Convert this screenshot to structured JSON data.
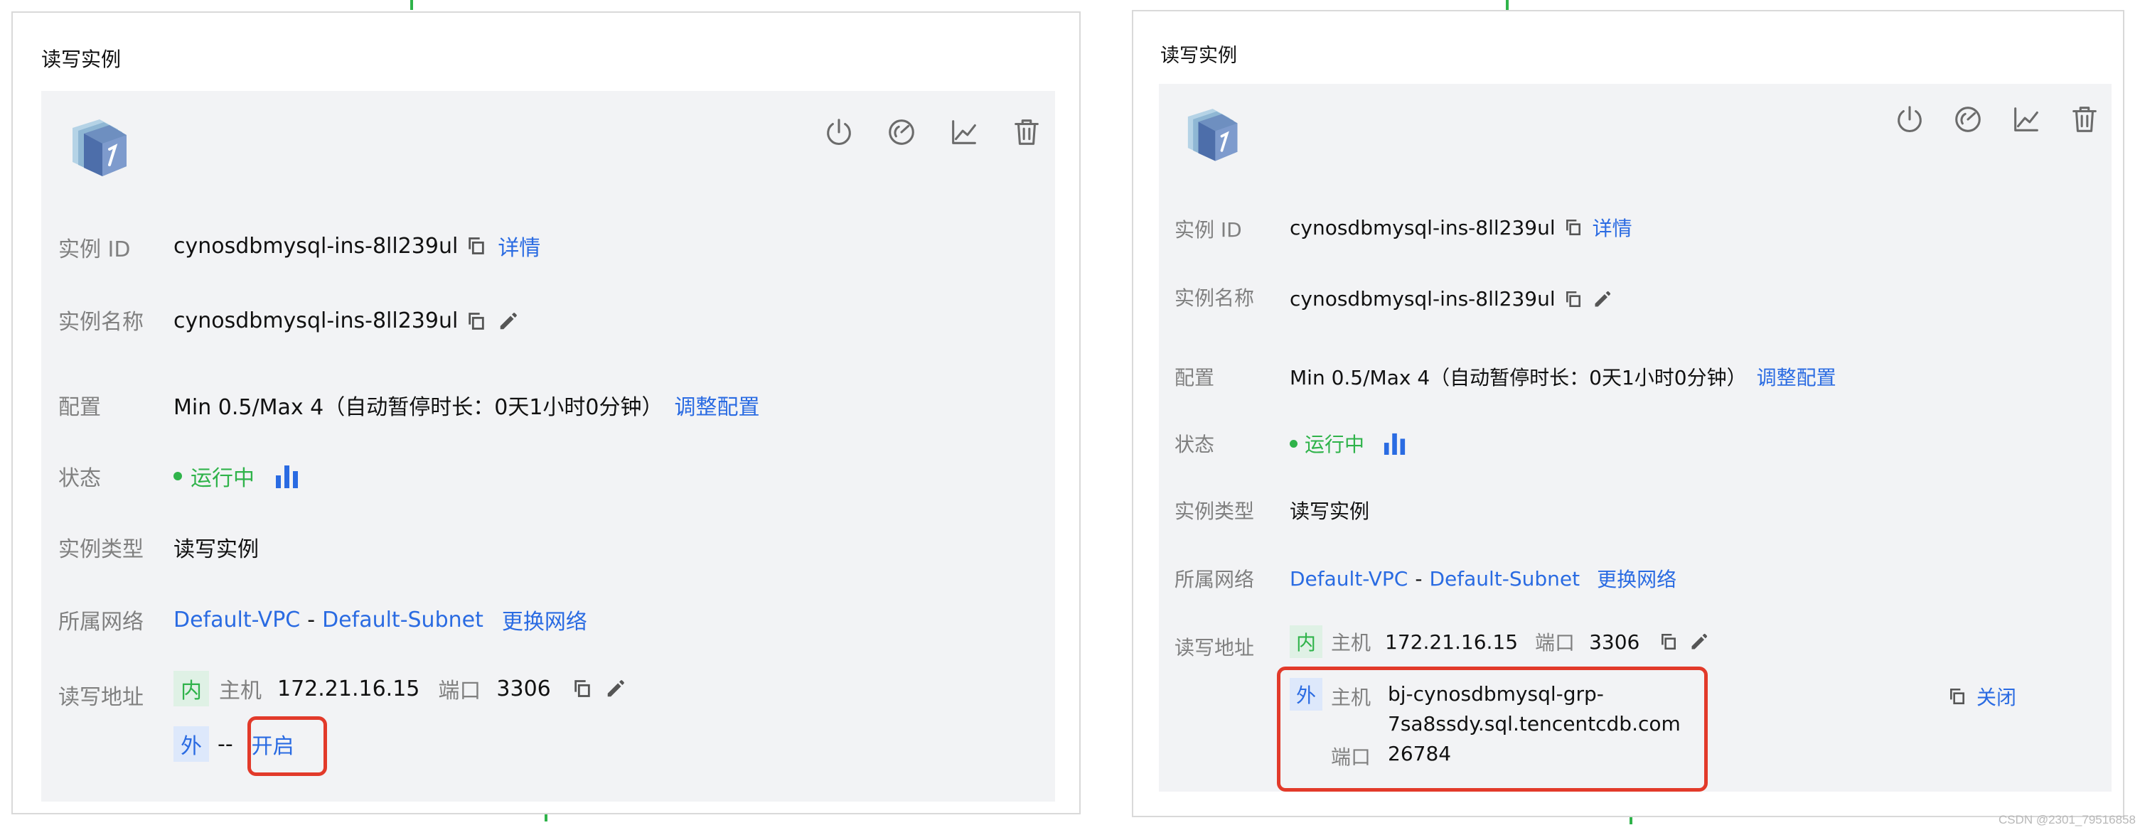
{
  "left": {
    "section_title": "读写实例",
    "toolbar_icons": [
      "power-icon",
      "gauge-icon",
      "line-chart-icon",
      "trash-icon"
    ],
    "instance_id_label": "实例 ID",
    "instance_id_value": "cynosdbmysql-ins-8ll239ul",
    "detail_link": "详情",
    "instance_name_label": "实例名称",
    "instance_name_value": "cynosdbmysql-ins-8ll239ul",
    "config_label": "配置",
    "config_value": "Min 0.5/Max 4（自动暂停时长：0天1小时0分钟）",
    "adjust_config_link": "调整配置",
    "status_label": "状态",
    "status_value": "运行中",
    "type_label": "实例类型",
    "type_value": "读写实例",
    "network_label": "所属网络",
    "vpc_link": "Default-VPC",
    "network_separator": "-",
    "subnet_link": "Default-Subnet",
    "change_network_link": "更换网络",
    "address_label": "读写地址",
    "internal_badge": "内",
    "host_label": "主机",
    "host_value": "172.21.16.15",
    "port_label": "端口",
    "port_value": "3306",
    "external_badge": "外",
    "external_placeholder": "--",
    "enable_link": "开启"
  },
  "right": {
    "section_title": "读写实例",
    "toolbar_icons": [
      "power-icon",
      "gauge-icon",
      "line-chart-icon",
      "trash-icon"
    ],
    "instance_id_label": "实例 ID",
    "instance_id_value": "cynosdbmysql-ins-8ll239ul",
    "detail_link": "详情",
    "instance_name_label": "实例名称",
    "instance_name_value": "cynosdbmysql-ins-8ll239ul",
    "config_label": "配置",
    "config_value": "Min 0.5/Max 4（自动暂停时长：0天1小时0分钟）",
    "adjust_config_link": "调整配置",
    "status_label": "状态",
    "status_value": "运行中",
    "type_label": "实例类型",
    "type_value": "读写实例",
    "network_label": "所属网络",
    "vpc_link": "Default-VPC",
    "network_separator": "-",
    "subnet_link": "Default-Subnet",
    "change_network_link": "更换网络",
    "address_label": "读写地址",
    "internal_badge": "内",
    "host_label": "主机",
    "host_value": "172.21.16.15",
    "port_label": "端口",
    "port_value": "3306",
    "external_badge": "外",
    "ext_host_label": "主机",
    "ext_host_line1": "bj-cynosdbmysql-grp-",
    "ext_host_line2": "7sa8ssdy.sql.tencentcdb.com",
    "ext_port_label": "端口",
    "ext_port_value": "26784",
    "close_link": "关闭"
  },
  "watermark": "CSDN @2301_79516858",
  "colors": {
    "link": "#2a6be2",
    "status_green": "#2fb34a",
    "highlight_red": "#e23a2a",
    "card_bg": "#f2f3f5"
  }
}
